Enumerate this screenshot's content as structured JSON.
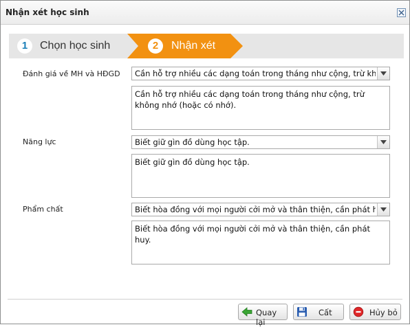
{
  "window": {
    "title": "Nhận xét học sinh"
  },
  "wizard": {
    "steps": [
      {
        "number": "1",
        "label": "Chọn học sinh"
      },
      {
        "number": "2",
        "label": "Nhận xét"
      }
    ],
    "active_step": 2
  },
  "form": {
    "mh_hdgd": {
      "label": "Đánh giá về MH và HĐGD",
      "selected": "Cần hỗ trợ nhiều  các dạng toán trong tháng như cộng, trừ không nhớ (hoặc có nhớ).",
      "text": "Cần hỗ trợ nhiều  các dạng toán trong tháng như cộng, trừ không nhớ (hoặc có nhớ)."
    },
    "nang_luc": {
      "label": "Năng lực",
      "selected": "Biết giữ gìn đồ dùng học tập.",
      "text": "Biết giữ gìn đồ dùng học tập."
    },
    "pham_chat": {
      "label": "Phẩm chất",
      "selected": "Biết hòa đồng với mọi người cởi mở và thân thiện, cần phát huy.",
      "text": "Biết hòa đồng với mọi người cởi mở và thân thiện, cần phát huy."
    }
  },
  "buttons": {
    "back": "Quay lại",
    "save": "Cất",
    "cancel": "Hủy bỏ"
  },
  "colors": {
    "active_step": "#f29111",
    "inactive_step": "#e6e6e6",
    "step1_number": "#1a7fb8"
  },
  "icons": {
    "back": "green-left-arrow-icon",
    "save": "floppy-disk-icon",
    "cancel": "red-no-sign-icon",
    "close": "close-x-icon"
  }
}
